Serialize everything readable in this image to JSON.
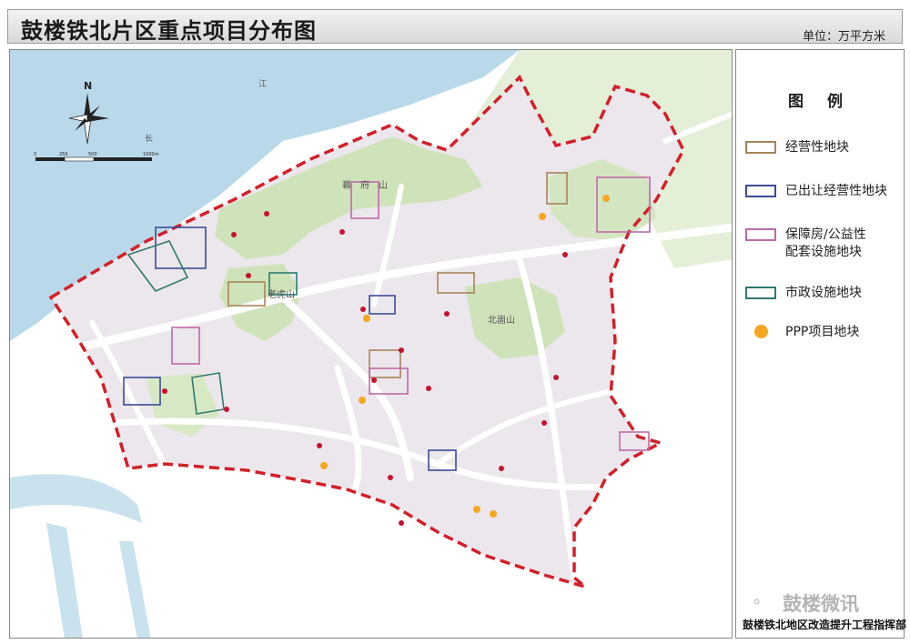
{
  "header": {
    "title": "鼓楼铁北片区重点项目分布图",
    "unit": "单位：万平方米"
  },
  "map": {
    "north_label": "N",
    "scale_labels": [
      "0",
      "250",
      "500",
      "1000m"
    ],
    "place_labels": {
      "jiang": "江",
      "chang": "长",
      "mufu": "幕　府　山",
      "laohu": "老虎山",
      "beidu": "北崮山"
    },
    "colors": {
      "water": "#b9d9ea",
      "green": "#d8e9c5",
      "urban": "#ebe6eb",
      "boundary": "#d1202a",
      "ppp": "#f5a623",
      "project_dot": "#c4122f"
    }
  },
  "legend": {
    "title": "图 例",
    "items": [
      {
        "label": "经营性地块",
        "stroke": "#a8835a"
      },
      {
        "label": "已出让经营性地块",
        "stroke": "#3b4b9a"
      },
      {
        "label": "保障房/公益性\n配套设施地块",
        "stroke": "#c06aa8"
      },
      {
        "label": "市政设施地块",
        "stroke": "#2f7a6e"
      },
      {
        "label": "PPP项目地块",
        "marker": "dot"
      }
    ]
  },
  "watermark": "鼓楼微讯",
  "footer": {
    "org": "鼓楼铁北地区改造提升工程指挥部"
  }
}
